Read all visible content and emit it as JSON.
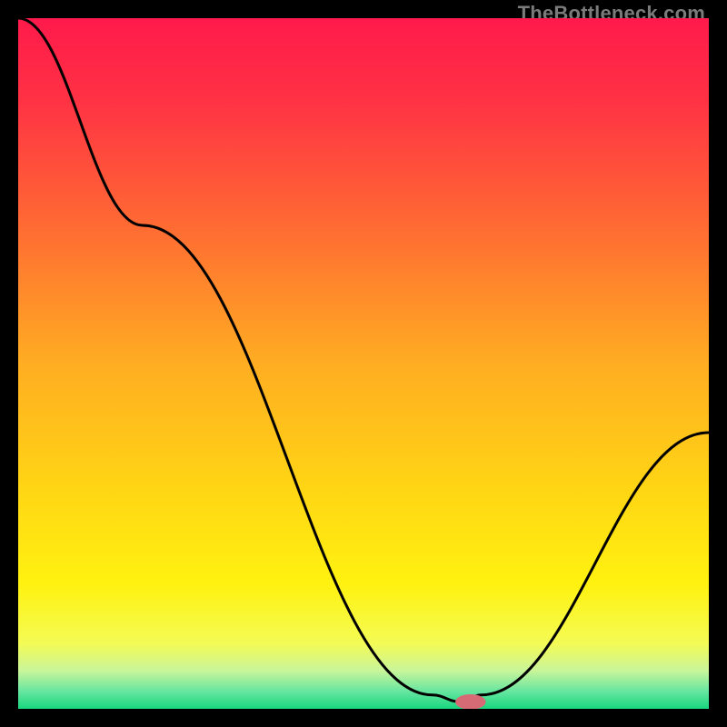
{
  "watermark": "TheBottleneck.com",
  "chart_data": {
    "type": "line",
    "title": "",
    "xlabel": "",
    "ylabel": "",
    "xlim": [
      0,
      100
    ],
    "ylim": [
      0,
      100
    ],
    "grid": false,
    "legend": false,
    "series": [
      {
        "name": "bottleneck-curve",
        "x": [
          0,
          18,
          60,
          64,
          67,
          100
        ],
        "y": [
          100,
          70,
          2,
          1,
          2,
          40
        ]
      }
    ],
    "marker": {
      "name": "optimal-point",
      "x": 65.5,
      "y": 1,
      "rx": 2.2,
      "ry": 1.1,
      "color": "#d66b76"
    },
    "background_gradient": {
      "stops": [
        {
          "offset": 0.0,
          "color": "#ff1a4b"
        },
        {
          "offset": 0.12,
          "color": "#ff3244"
        },
        {
          "offset": 0.3,
          "color": "#ff6a33"
        },
        {
          "offset": 0.5,
          "color": "#ffad22"
        },
        {
          "offset": 0.68,
          "color": "#ffd514"
        },
        {
          "offset": 0.82,
          "color": "#fff210"
        },
        {
          "offset": 0.905,
          "color": "#f4fb55"
        },
        {
          "offset": 0.945,
          "color": "#c9f59a"
        },
        {
          "offset": 0.975,
          "color": "#66e6a0"
        },
        {
          "offset": 1.0,
          "color": "#18d67e"
        }
      ]
    }
  }
}
